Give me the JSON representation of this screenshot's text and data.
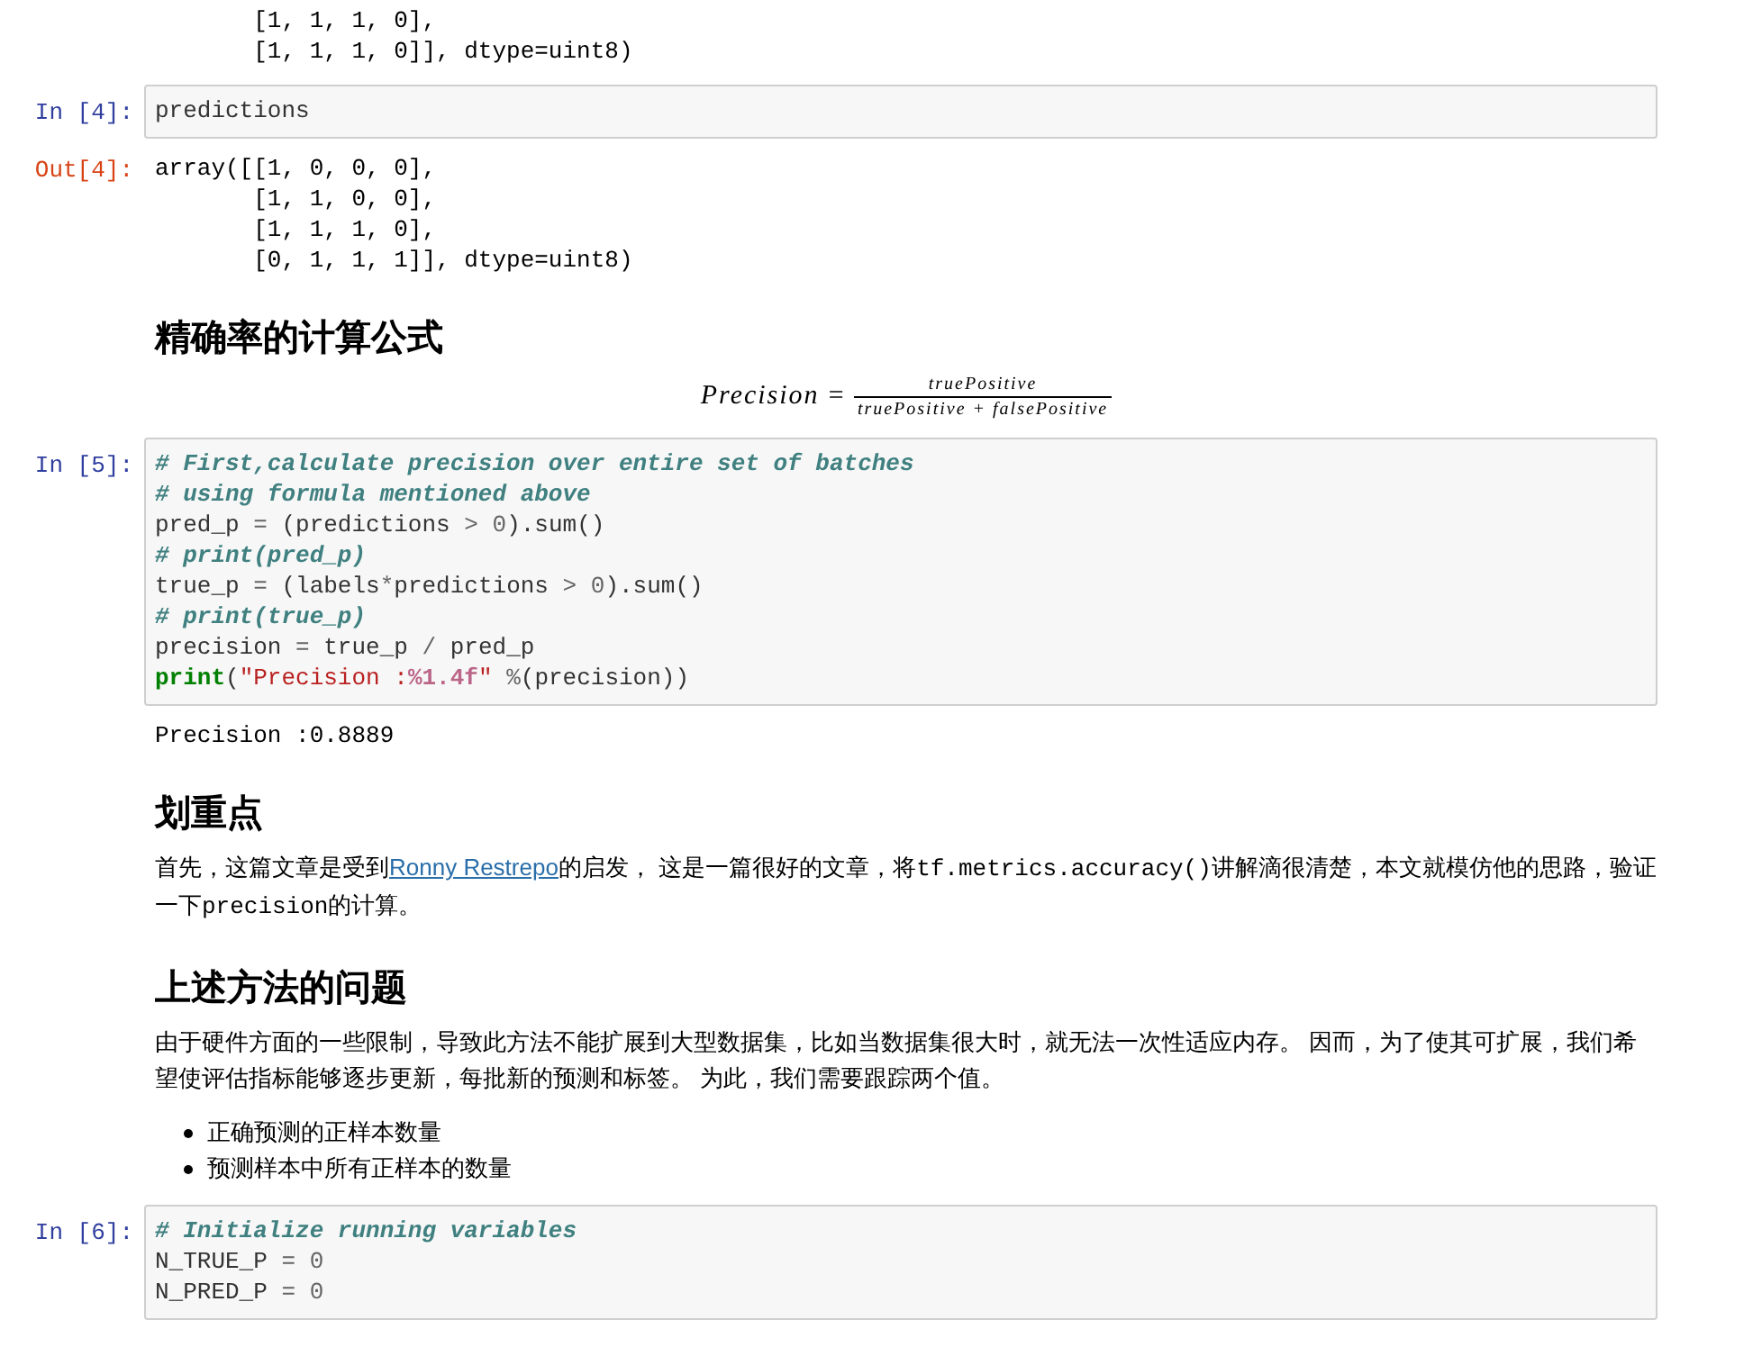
{
  "cells": [
    {
      "kind": "output",
      "lines": [
        "       [1, 1, 1, 0],",
        "       [1, 1, 1, 0]], dtype=uint8)"
      ]
    },
    {
      "kind": "input",
      "prompt": "In [4]:",
      "lines": [
        [
          {
            "kind": "plain",
            "text": "predictions"
          }
        ]
      ]
    },
    {
      "kind": "output",
      "prompt": "Out[4]:",
      "lines": [
        "array([[1, 0, 0, 0],",
        "       [1, 1, 0, 0],",
        "       [1, 1, 1, 0],",
        "       [0, 1, 1, 1]], dtype=uint8)"
      ]
    },
    {
      "kind": "heading",
      "text": "精确率的计算公式"
    },
    {
      "kind": "formula",
      "lhs": "Precision",
      "equals": "=",
      "numerator": "truePositive",
      "denominator": "truePositive + falsePositive"
    },
    {
      "kind": "input",
      "prompt": "In [5]:",
      "lines": [
        [
          {
            "kind": "comment",
            "text": "# First,calculate precision over entire set of batches"
          }
        ],
        [
          {
            "kind": "comment",
            "text": "# using formula mentioned above"
          }
        ],
        [
          {
            "kind": "plain",
            "text": "pred_p "
          },
          {
            "kind": "operator",
            "text": "="
          },
          {
            "kind": "plain",
            "text": " (predictions "
          },
          {
            "kind": "operator",
            "text": "> "
          },
          {
            "kind": "number",
            "text": "0"
          },
          {
            "kind": "plain",
            "text": ").sum()"
          }
        ],
        [
          {
            "kind": "comment",
            "text": "# print(pred_p)"
          }
        ],
        [
          {
            "kind": "plain",
            "text": "true_p "
          },
          {
            "kind": "operator",
            "text": "="
          },
          {
            "kind": "plain",
            "text": " (labels"
          },
          {
            "kind": "operator",
            "text": "*"
          },
          {
            "kind": "plain",
            "text": "predictions "
          },
          {
            "kind": "operator",
            "text": "> "
          },
          {
            "kind": "number",
            "text": "0"
          },
          {
            "kind": "plain",
            "text": ").sum()"
          }
        ],
        [
          {
            "kind": "comment",
            "text": "# print(true_p)"
          }
        ],
        [
          {
            "kind": "plain",
            "text": "precision "
          },
          {
            "kind": "operator",
            "text": "="
          },
          {
            "kind": "plain",
            "text": " true_p "
          },
          {
            "kind": "operator",
            "text": "/"
          },
          {
            "kind": "plain",
            "text": " pred_p"
          }
        ],
        [
          {
            "kind": "builtin",
            "text": "print"
          },
          {
            "kind": "plain",
            "text": "("
          },
          {
            "kind": "string",
            "text": "\"Precision :"
          },
          {
            "kind": "interp",
            "text": "%1.4f"
          },
          {
            "kind": "string",
            "text": "\" "
          },
          {
            "kind": "operator",
            "text": "%"
          },
          {
            "kind": "plain",
            "text": "(precision))"
          }
        ]
      ]
    },
    {
      "kind": "output",
      "lines": [
        "Precision :0.8889"
      ]
    },
    {
      "kind": "heading",
      "text": "划重点"
    },
    {
      "kind": "paragraph",
      "parts": [
        {
          "kind": "text",
          "text": "首先，这篇文章是受到"
        },
        {
          "kind": "link",
          "text": "Ronny Restrepo"
        },
        {
          "kind": "text",
          "text": "的启发， 这是一篇很好的文章，将"
        },
        {
          "kind": "code",
          "text": "tf.metrics.accuracy()"
        },
        {
          "kind": "text",
          "text": "讲解滴很清楚，本文就模仿他的思路，验证一下"
        },
        {
          "kind": "code",
          "text": "precision"
        },
        {
          "kind": "text",
          "text": "的计算。"
        }
      ]
    },
    {
      "kind": "heading",
      "text": "上述方法的问题"
    },
    {
      "kind": "paragraph",
      "parts": [
        {
          "kind": "text",
          "text": "由于硬件方面的一些限制，导致此方法不能扩展到大型数据集，比如当数据集很大时，就无法一次性适应内存。 因而，为了使其可扩展，我们希望使评估指标能够逐步更新，每批新的预测和标签。 为此，我们需要跟踪两个值。"
        }
      ]
    },
    {
      "kind": "list",
      "items": [
        "正确预测的正样本数量",
        "预测样本中所有正样本的数量"
      ]
    },
    {
      "kind": "input",
      "prompt": "In [6]:",
      "lines": [
        [
          {
            "kind": "comment",
            "text": "# Initialize running variables"
          }
        ],
        [
          {
            "kind": "plain",
            "text": "N_TRUE_P "
          },
          {
            "kind": "operator",
            "text": "= "
          },
          {
            "kind": "number",
            "text": "0"
          }
        ],
        [
          {
            "kind": "plain",
            "text": "N_PRED_P "
          },
          {
            "kind": "operator",
            "text": "= "
          },
          {
            "kind": "number",
            "text": "0"
          }
        ]
      ]
    }
  ]
}
